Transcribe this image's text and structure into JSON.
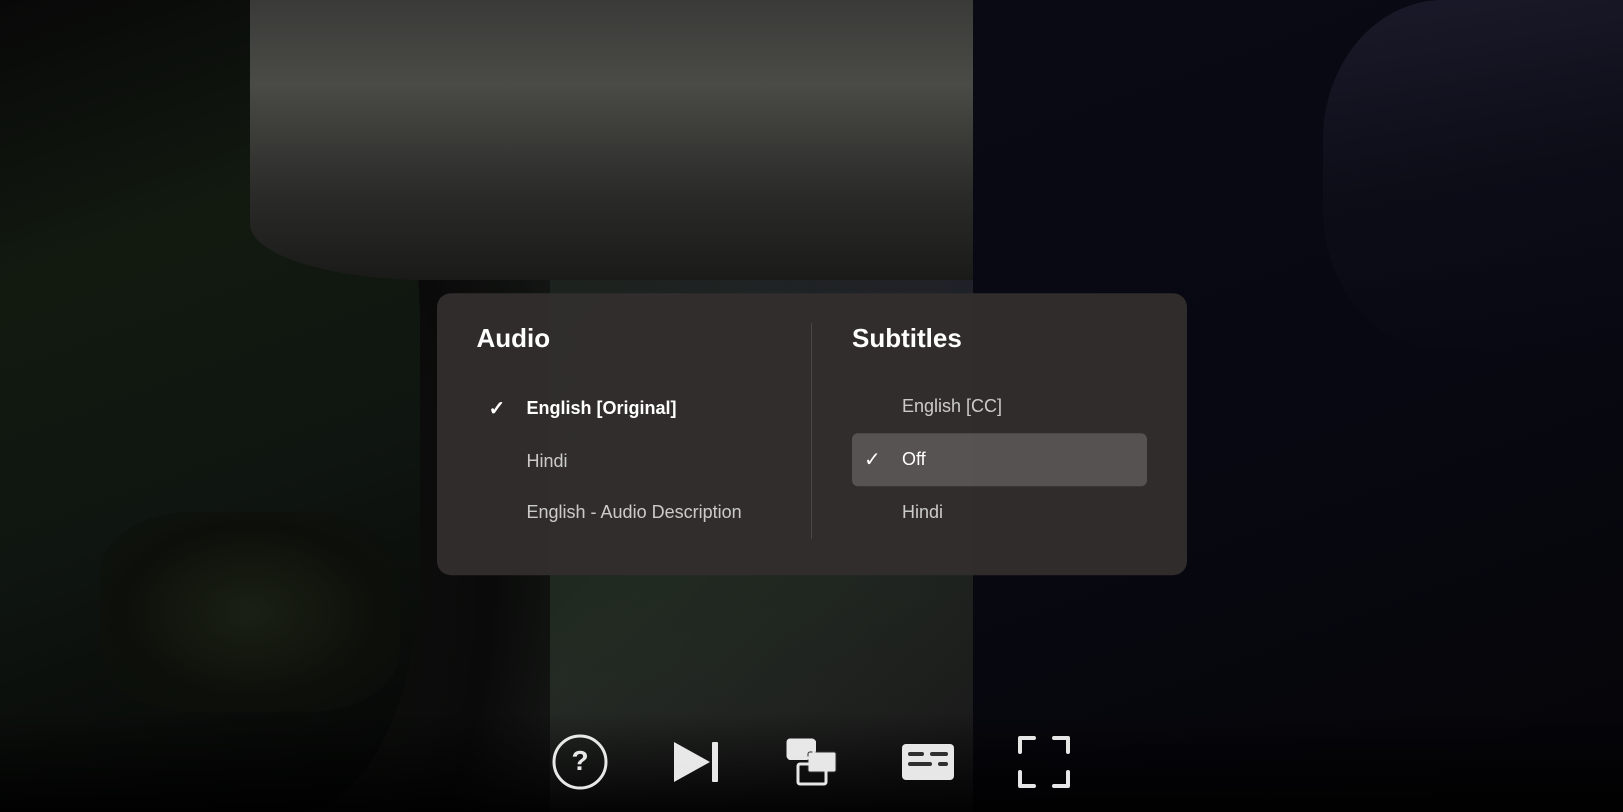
{
  "scene": {
    "background_description": "Dark movie scene with figures in dim light"
  },
  "panel": {
    "audio": {
      "header": "Audio",
      "items": [
        {
          "id": "english-original",
          "label": "English [Original]",
          "selected": true
        },
        {
          "id": "hindi",
          "label": "Hindi",
          "selected": false
        },
        {
          "id": "english-audio-description",
          "label": "English - Audio Description",
          "selected": false
        }
      ]
    },
    "subtitles": {
      "header": "Subtitles",
      "items": [
        {
          "id": "english-cc",
          "label": "English [CC]",
          "selected": false
        },
        {
          "id": "off",
          "label": "Off",
          "selected": true
        },
        {
          "id": "hindi",
          "label": "Hindi",
          "selected": false
        }
      ]
    }
  },
  "controls": {
    "help_label": "Help",
    "next_label": "Next Episode",
    "episodes_label": "Episodes",
    "subtitles_label": "Subtitles and Audio",
    "fullscreen_label": "Fullscreen"
  }
}
